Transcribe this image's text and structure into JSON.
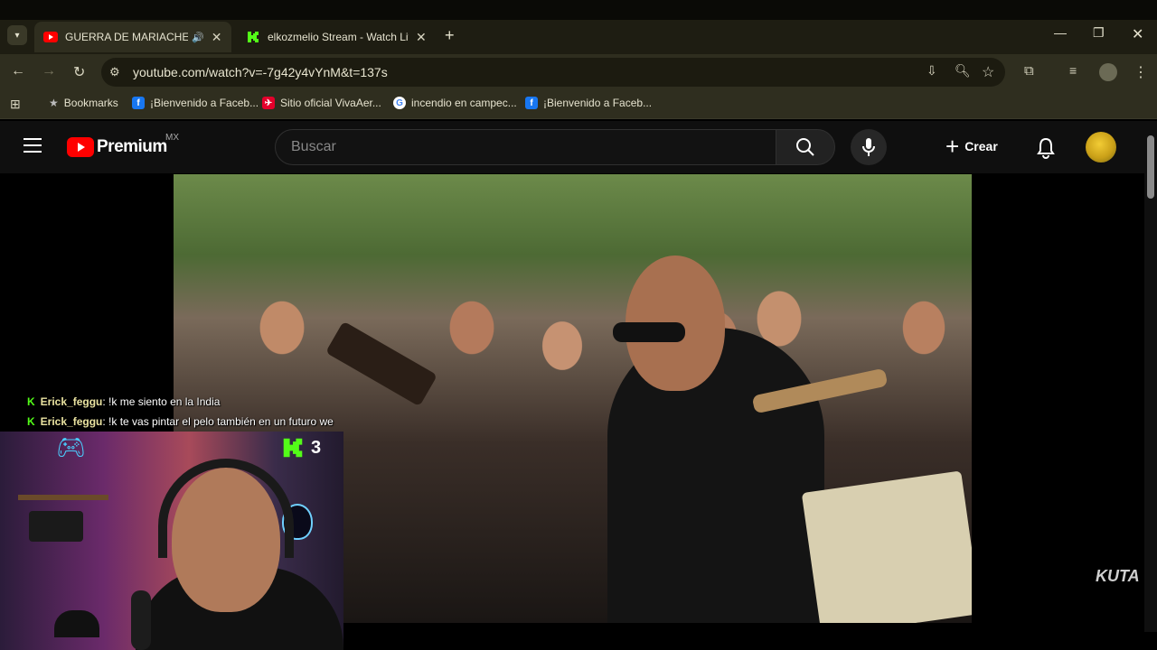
{
  "browser": {
    "tabs": [
      {
        "title": "GUERRA DE MARIACHEROS",
        "active": true
      },
      {
        "title": "elkozmelio Stream - Watch Live",
        "active": false
      }
    ],
    "new_tab": "+",
    "url": "youtube.com/watch?v=-7g42y4vYnM&t=137s",
    "bookmarks": [
      {
        "label": "Bookmarks",
        "icon": "star-icon"
      },
      {
        "label": "¡Bienvenido a Faceb...",
        "icon": "facebook-icon"
      },
      {
        "label": "Sitio oficial VivaAer...",
        "icon": "vivaaerobus-icon"
      },
      {
        "label": "incendio en campec...",
        "icon": "google-icon"
      },
      {
        "label": "¡Bienvenido a Faceb...",
        "icon": "facebook-icon"
      }
    ]
  },
  "youtube": {
    "logo_text": "Premium",
    "region": "MX",
    "search_placeholder": "Buscar",
    "create_label": "Crear"
  },
  "overlay": {
    "chat": [
      {
        "user": "Erick_feggu",
        "message": ": !k me siento en la India"
      },
      {
        "user": "Erick_feggu",
        "message": ": !k te vas pintar el pelo también en un futuro we"
      }
    ],
    "kick_badge": "3",
    "watermark": "KUTA"
  },
  "colors": {
    "kick_green": "#53fc18",
    "youtube_red": "#ff0000"
  }
}
